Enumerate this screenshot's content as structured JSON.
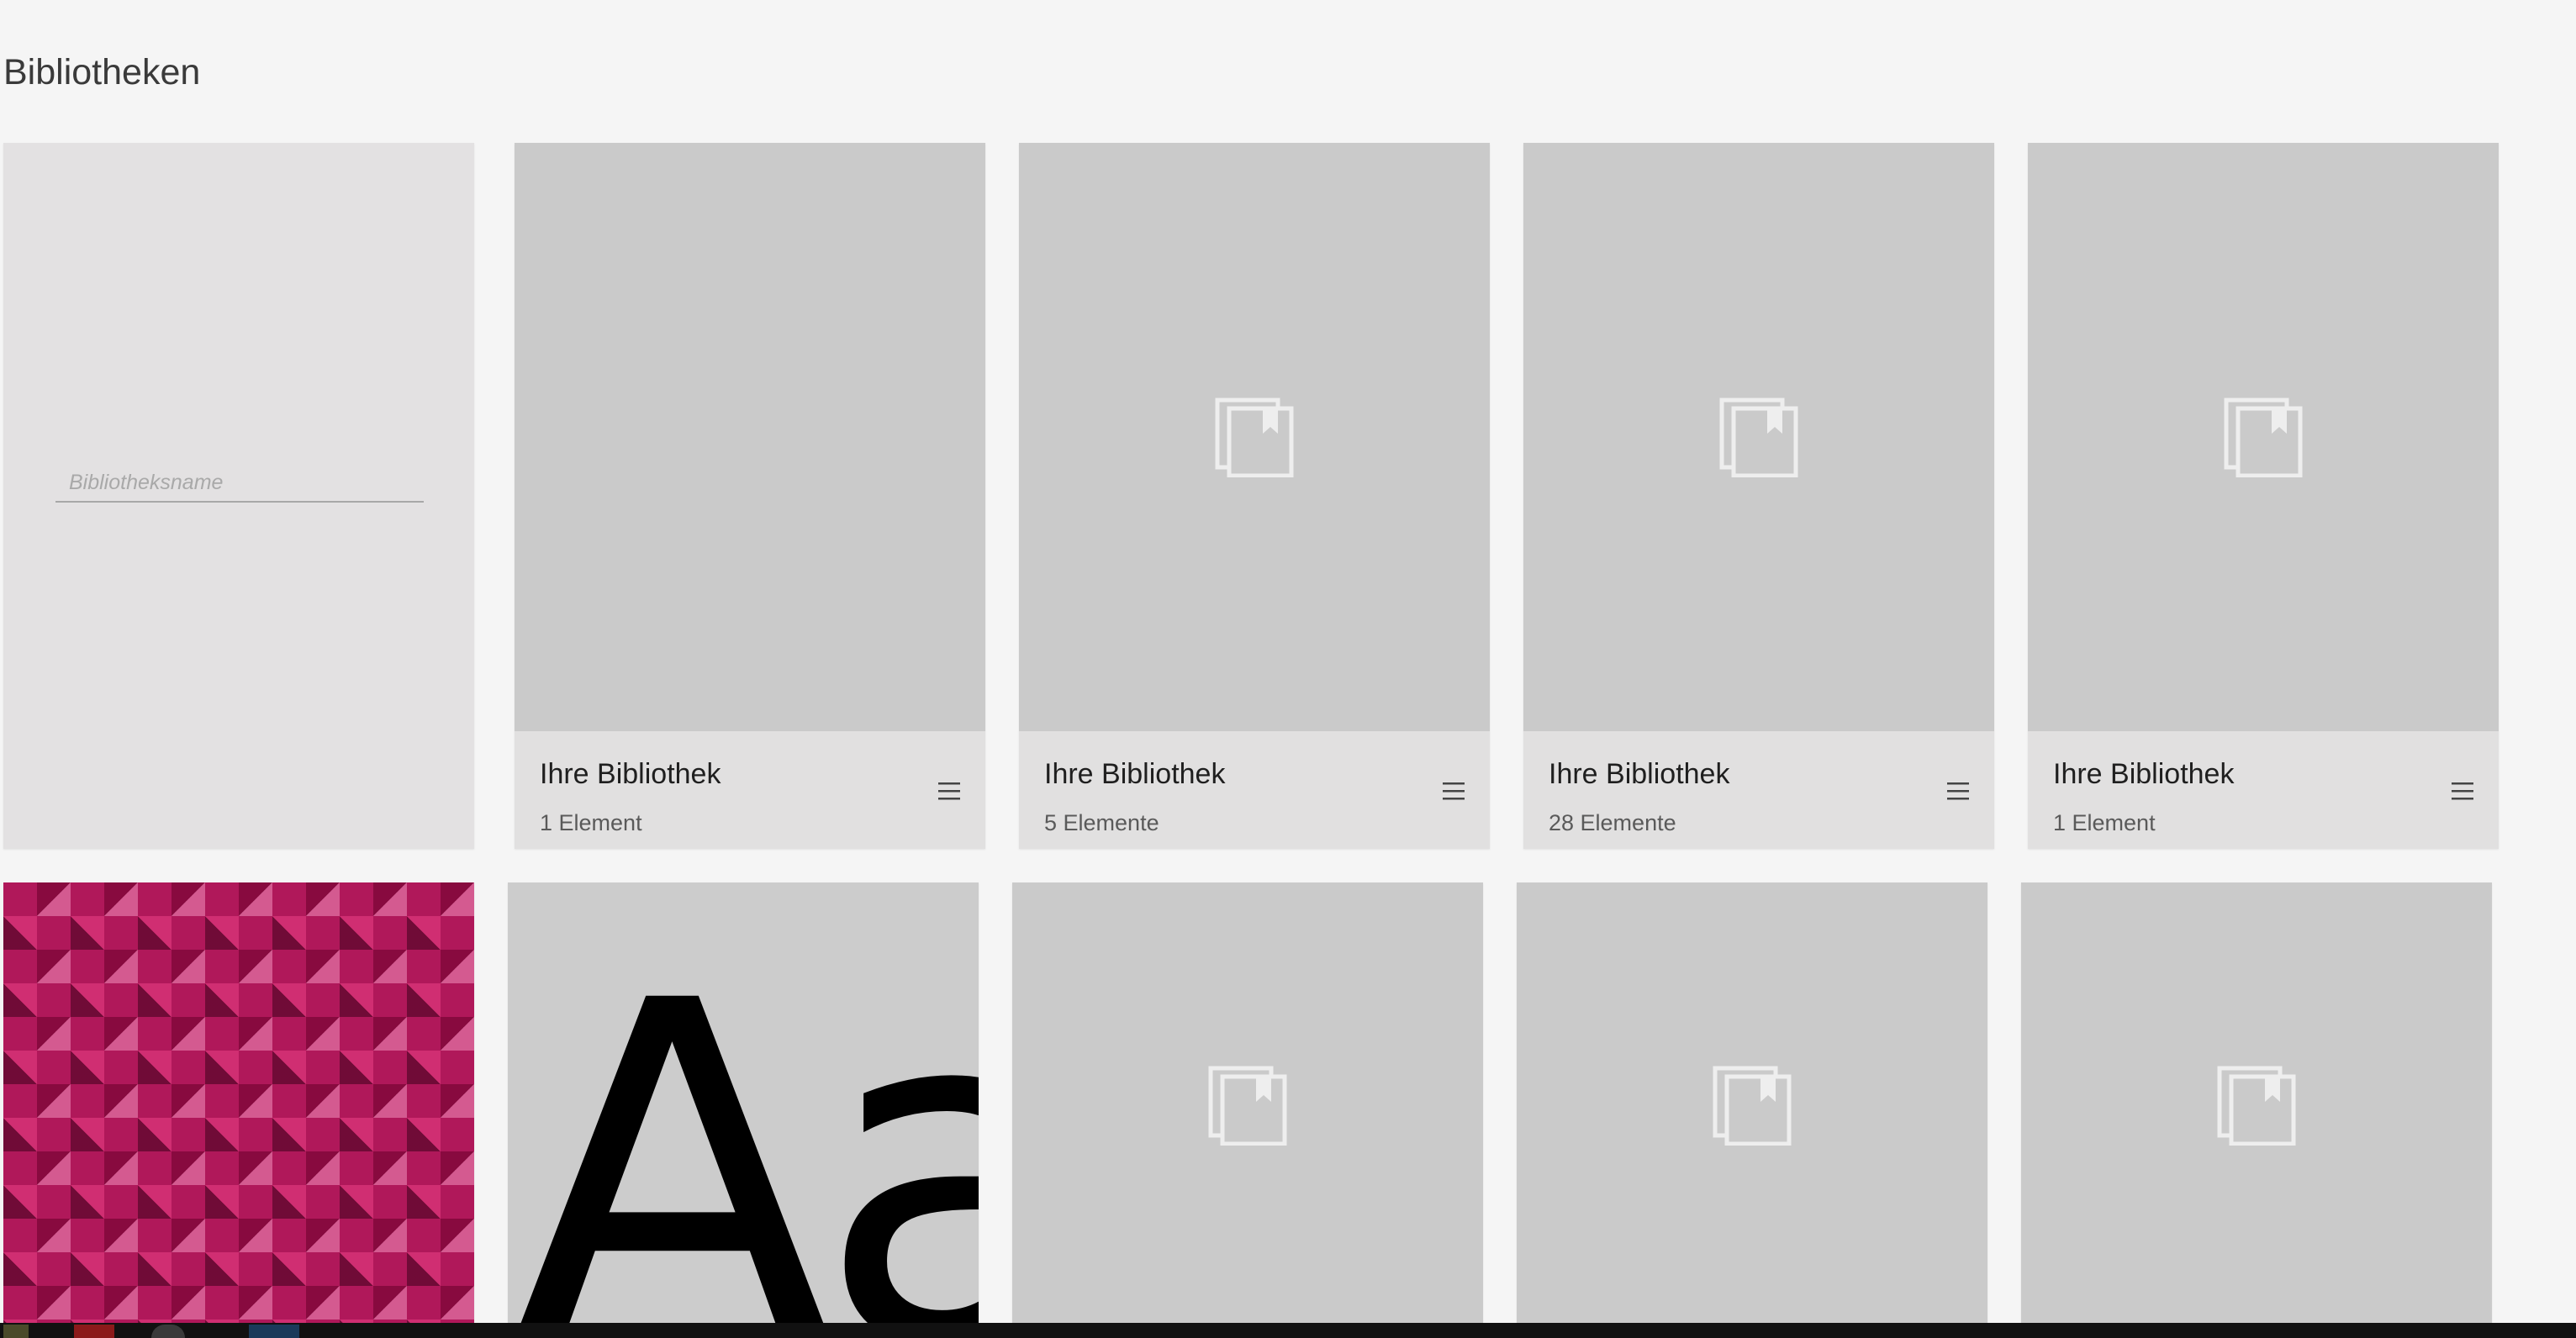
{
  "header": {
    "title": "Bibliotheken"
  },
  "new_library": {
    "placeholder": "Bibliotheksname"
  },
  "libraries_row1": [
    {
      "name": "Ihre Bibliothek",
      "count": "1 Element",
      "icon": "library-icon",
      "has_icon": false
    },
    {
      "name": "Ihre Bibliothek",
      "count": "5 Elemente",
      "icon": "library-icon",
      "has_icon": true
    },
    {
      "name": "Ihre Bibliothek",
      "count": "28 Elemente",
      "icon": "library-icon",
      "has_icon": true
    },
    {
      "name": "Ihre Bibliothek",
      "count": "1 Element",
      "icon": "library-icon",
      "has_icon": true
    }
  ],
  "libraries_row2": [
    {
      "thumb": "pattern-thumbnail"
    },
    {
      "thumb": "font-thumbnail",
      "glyphs": "Aa"
    },
    {
      "thumb": "library-icon"
    },
    {
      "thumb": "library-icon"
    },
    {
      "thumb": "library-icon"
    }
  ],
  "colors": {
    "background": "#f5f5f5",
    "thumbnail_gray": "#cacaca",
    "card_footer": "#e1e0e0",
    "pattern_accent": "#b0185a"
  },
  "taskbar": {
    "items": [
      "taskbar-app-pdf-icon",
      "taskbar-app-chrome-icon",
      "taskbar-app-explorer-icon"
    ]
  }
}
